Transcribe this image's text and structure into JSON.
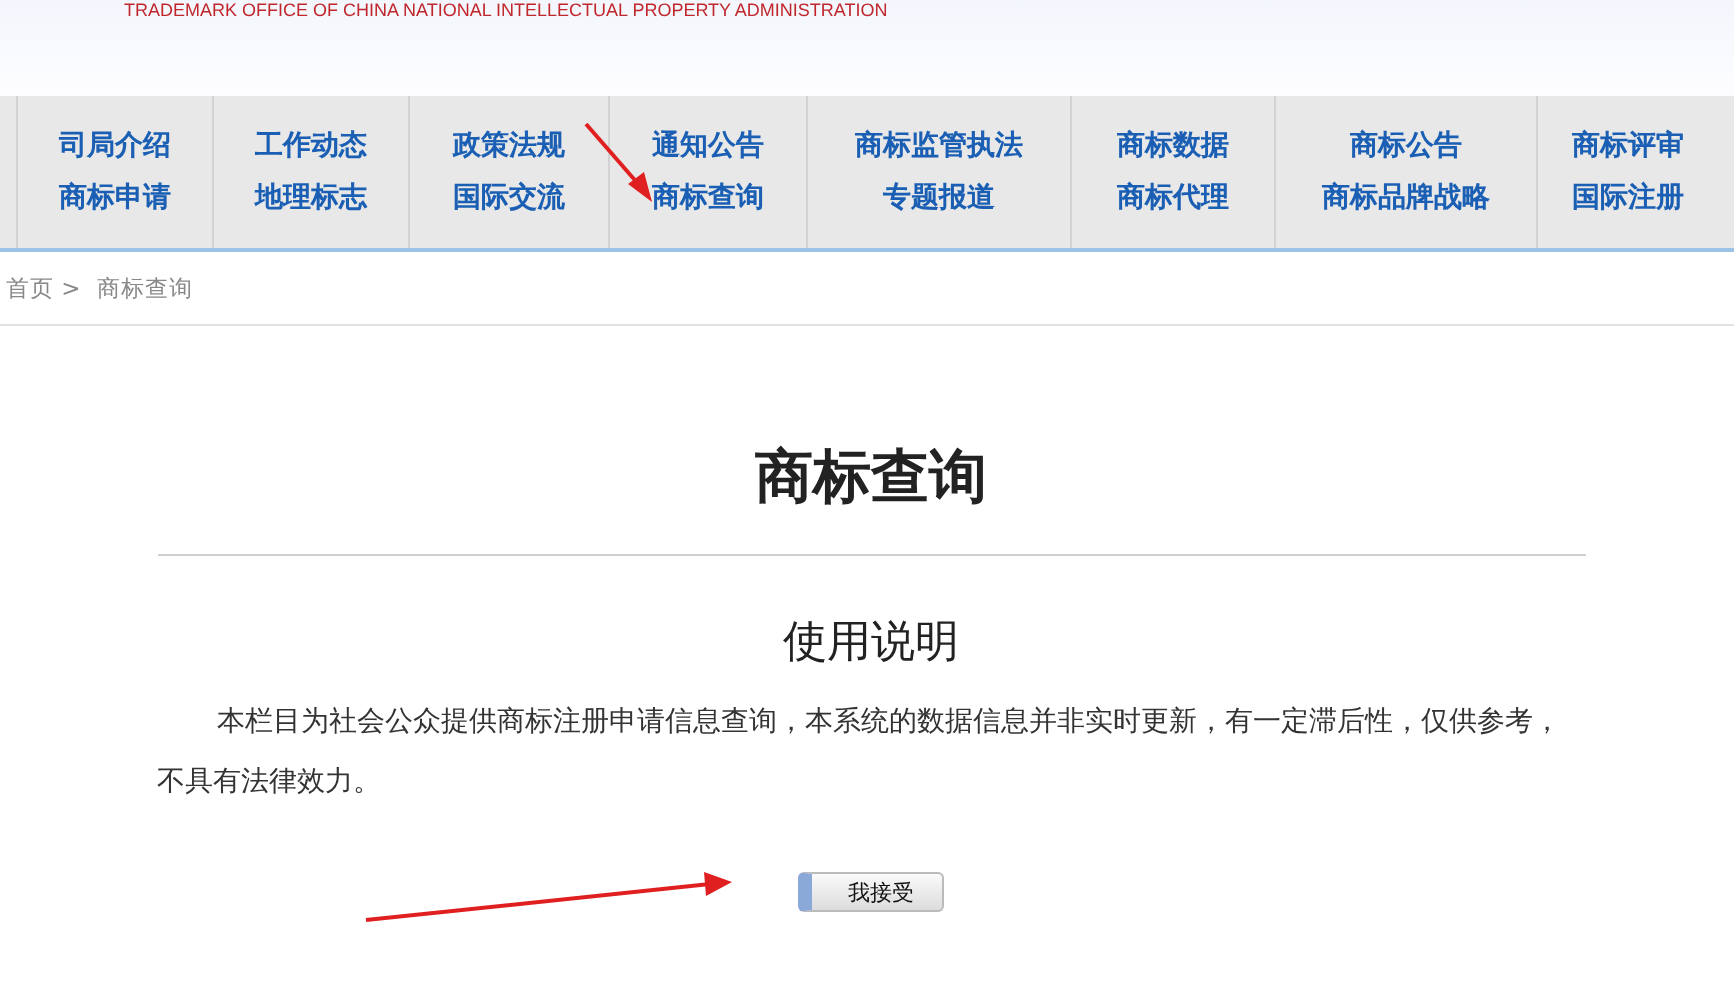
{
  "header": {
    "subtitle": "TRADEMARK OFFICE OF CHINA NATIONAL INTELLECTUAL PROPERTY ADMINISTRATION"
  },
  "nav": {
    "columns": [
      [
        "司局介绍",
        "商标申请"
      ],
      [
        "工作动态",
        "地理标志"
      ],
      [
        "政策法规",
        "国际交流"
      ],
      [
        "通知公告",
        "商标查询"
      ],
      [
        "商标监管执法",
        "专题报道"
      ],
      [
        "商标数据",
        "商标代理"
      ],
      [
        "商标公告",
        "商标品牌战略"
      ],
      [
        "商标评审",
        "国际注册"
      ]
    ]
  },
  "breadcrumb": [
    "首页 >",
    "商标查询"
  ],
  "title": "商标查询",
  "section_title": "使用说明",
  "paragraph": "本栏目为社会公众提供商标注册申请信息查询，本系统的数据信息并非实时更新，有一定滞后性，仅供参考，不具有法律效力。",
  "accept_button": "我接受"
}
